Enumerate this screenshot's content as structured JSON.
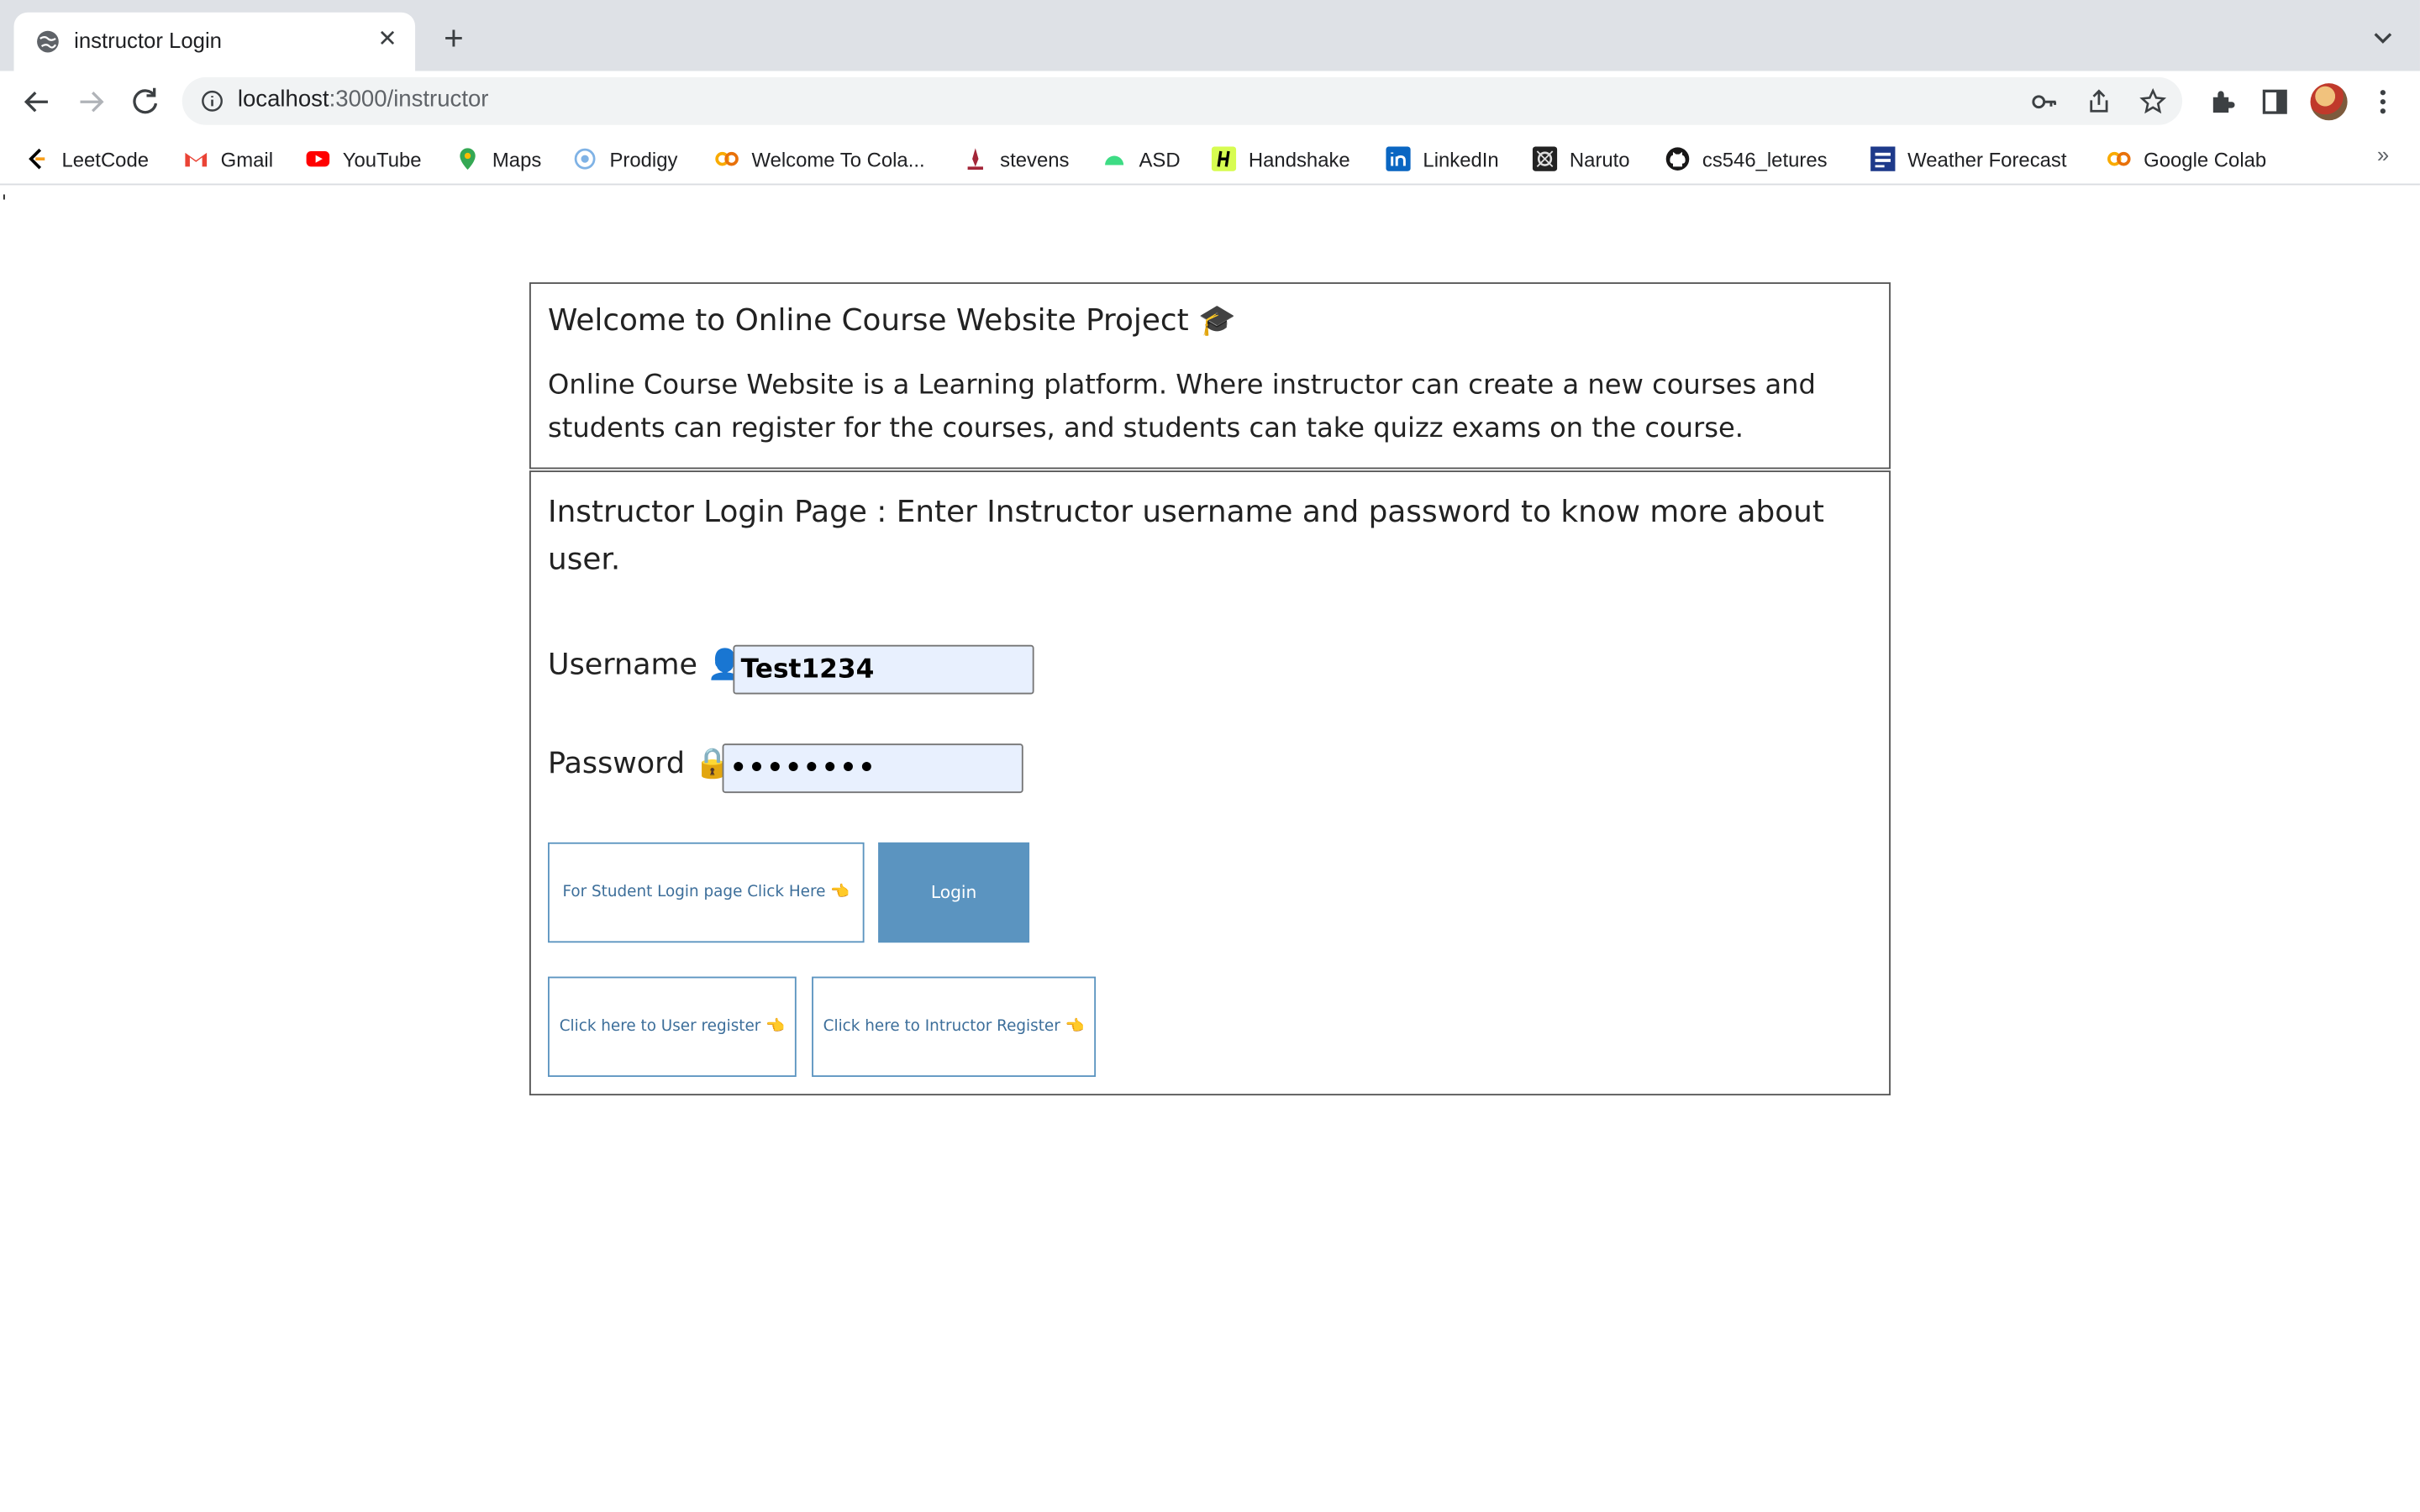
{
  "browser": {
    "tab_title": "instructor Login",
    "url_host": "localhost",
    "url_path": ":3000/instructor"
  },
  "bookmarks": [
    {
      "label": "LeetCode",
      "icon": "leetcode-icon",
      "color": "#f89f1b"
    },
    {
      "label": "Gmail",
      "icon": "gmail-icon",
      "color": "#ea4335"
    },
    {
      "label": "YouTube",
      "icon": "youtube-icon",
      "color": "#ff0000"
    },
    {
      "label": "Maps",
      "icon": "maps-icon",
      "color": "#34a853"
    },
    {
      "label": "Prodigy",
      "icon": "prodigy-icon",
      "color": "#7fb2e5"
    },
    {
      "label": "Welcome To Cola...",
      "icon": "colab-icon",
      "color": "#f9ab00"
    },
    {
      "label": "stevens",
      "icon": "stevens-icon",
      "color": "#a32638"
    },
    {
      "label": "ASD",
      "icon": "android-icon",
      "color": "#3ddc84"
    },
    {
      "label": "Handshake",
      "icon": "handshake-icon",
      "color": "#d7fc51"
    },
    {
      "label": "LinkedIn",
      "icon": "linkedin-icon",
      "color": "#0a66c2"
    },
    {
      "label": "Naruto",
      "icon": "naruto-icon",
      "color": "#222222"
    },
    {
      "label": "cs546_letures",
      "icon": "github-icon",
      "color": "#181717"
    },
    {
      "label": "Weather Forecast",
      "icon": "weather-icon",
      "color": "#1e3a8a"
    },
    {
      "label": "Google Colab",
      "icon": "colab-icon",
      "color": "#f9ab00"
    }
  ],
  "page": {
    "stray_char": "'",
    "welcome_title": "Welcome to Online Course Website Project 🎓",
    "welcome_desc": "Online Course Website is a Learning platform. Where instructor can create a new courses and students can register for the courses, and students can take quizz exams on the course.",
    "login_heading": "Instructor Login Page : Enter Instructor username and password to know more about user.",
    "username_label": "Username 👤",
    "username_value": "Test1234",
    "password_label": "Password 🔒",
    "password_value": "••••••••",
    "student_login_button": "For Student Login page Click Here 👈",
    "login_button": "Login",
    "user_register_button": "Click here to User register 👈",
    "instructor_register_button": "Click here to Intructor Register 👈"
  },
  "colors": {
    "accent": "#5b94c0",
    "input_bg": "#e8f0fe"
  }
}
